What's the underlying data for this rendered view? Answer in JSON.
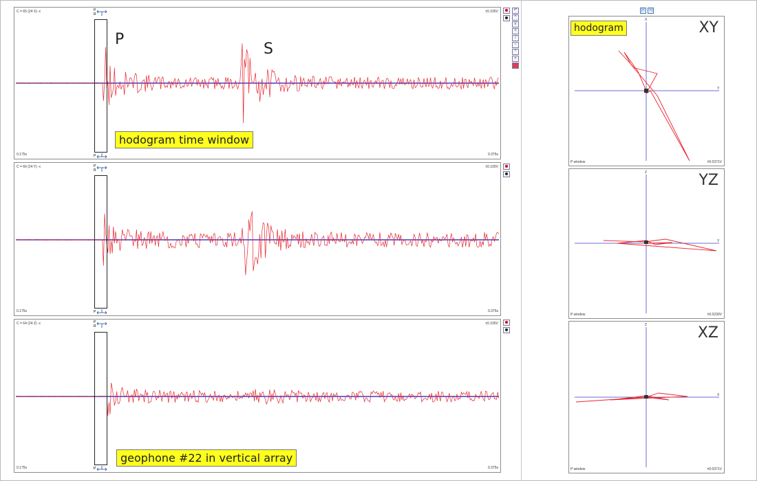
{
  "traces": [
    {
      "name": "C = 65 (24 X) -c",
      "scale": "±0.105V",
      "t_start": "0.175s",
      "t_end": "0.375s"
    },
    {
      "name": "C = 66 (24 Y) -c",
      "scale": "±0.105V",
      "t_start": "0.175s",
      "t_end": "0.375s"
    },
    {
      "name": "C = 64 (24 Z) -c",
      "scale": "±0.105V",
      "t_start": "0.175s",
      "t_end": "0.375s"
    }
  ],
  "window_markers": {
    "p": "P",
    "r": "R",
    "e": "P"
  },
  "phase_labels": {
    "p": "P",
    "s": "S"
  },
  "callouts": {
    "time_window": "hodogram time window",
    "geophone": "geophone #22 in vertical array",
    "hodogram": "hodogram"
  },
  "hodograms": [
    {
      "label": "XY",
      "h_axis": "Y",
      "v_axis": "X",
      "window": "P window",
      "scale": "±0.0371V"
    },
    {
      "label": "YZ",
      "h_axis": "Y",
      "v_axis": "Z",
      "window": "P window",
      "scale": "±0.0230V"
    },
    {
      "label": "XZ",
      "h_axis": "X",
      "v_axis": "Z",
      "window": "P window",
      "scale": "±0.0371V"
    }
  ],
  "colors": {
    "trace": "#e8242c",
    "baseline": "#3b3bcc",
    "callout": "#ffff1e",
    "axis": "#6b6bd6"
  },
  "icons": {
    "toolbar": [
      "undo-icon",
      "arrow-up-icon",
      "arrow-down-icon",
      "zoom-icon",
      "cursor-icon",
      "filter-icon",
      "settings-icon",
      "print-icon",
      "chart-icon"
    ],
    "nav": [
      "first-icon",
      "last-icon"
    ]
  }
}
